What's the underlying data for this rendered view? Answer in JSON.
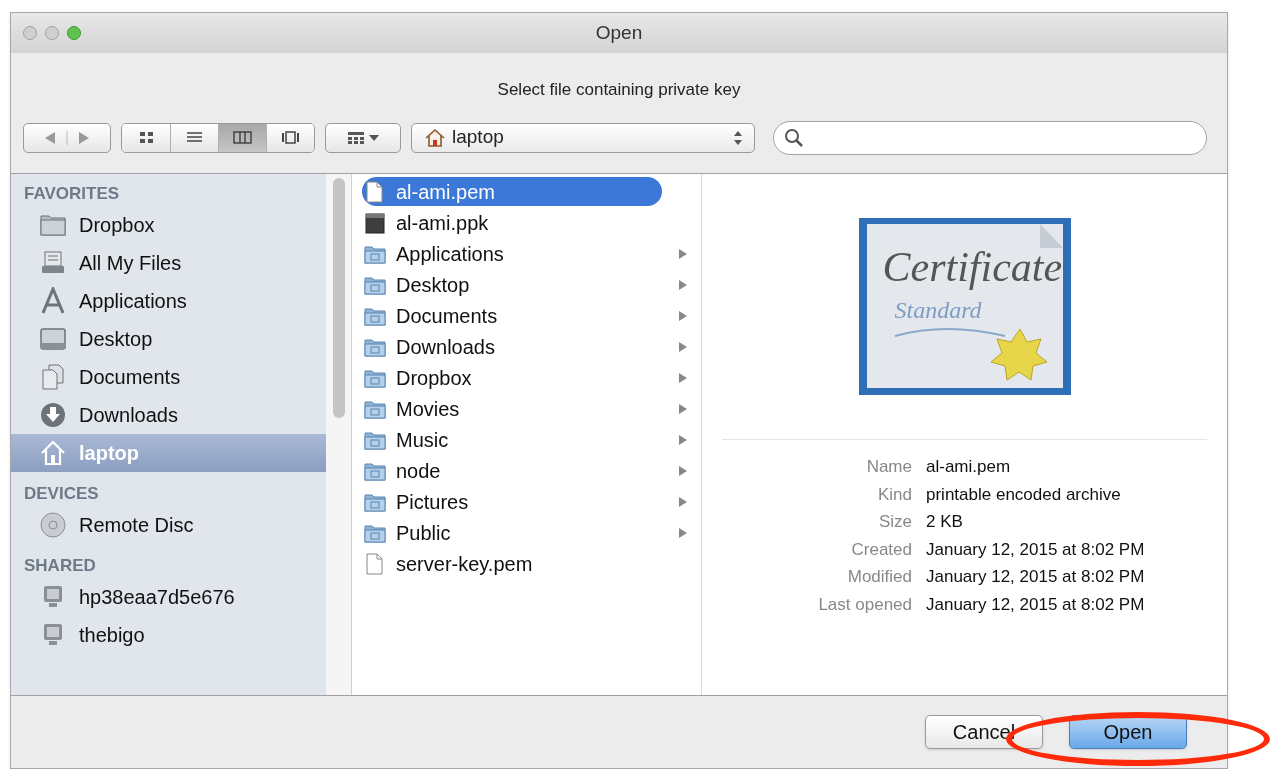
{
  "window": {
    "title": "Open"
  },
  "prompt": "Select file containing private key",
  "toolbar": {
    "views": [
      {
        "kind": "icons",
        "selected": false
      },
      {
        "kind": "list",
        "selected": false
      },
      {
        "kind": "columns",
        "selected": true
      },
      {
        "kind": "coverflow",
        "selected": false
      }
    ],
    "location": "laptop"
  },
  "sidebar": {
    "sections": [
      {
        "title": "FAVORITES",
        "items": [
          {
            "label": "Dropbox",
            "kind": "folder",
            "selected": false
          },
          {
            "label": "All My Files",
            "kind": "files",
            "selected": false
          },
          {
            "label": "Applications",
            "kind": "apps",
            "selected": false
          },
          {
            "label": "Desktop",
            "kind": "desktop",
            "selected": false
          },
          {
            "label": "Documents",
            "kind": "documents",
            "selected": false
          },
          {
            "label": "Downloads",
            "kind": "downloads",
            "selected": false
          },
          {
            "label": "laptop",
            "kind": "home",
            "selected": true
          }
        ]
      },
      {
        "title": "DEVICES",
        "items": [
          {
            "label": "Remote Disc",
            "kind": "disc",
            "selected": false
          }
        ]
      },
      {
        "title": "SHARED",
        "items": [
          {
            "label": "hp38eaa7d5e676",
            "kind": "computer",
            "selected": false
          },
          {
            "label": "thebigo",
            "kind": "computer",
            "selected": false
          }
        ]
      }
    ]
  },
  "files": [
    {
      "name": "al-ami.pem",
      "kind": "document",
      "expandable": false,
      "selected": true
    },
    {
      "name": "al-ami.ppk",
      "kind": "dark-document",
      "expandable": false,
      "selected": false
    },
    {
      "name": "Applications",
      "kind": "folder",
      "expandable": true,
      "selected": false
    },
    {
      "name": "Desktop",
      "kind": "folder",
      "expandable": true,
      "selected": false
    },
    {
      "name": "Documents",
      "kind": "folder",
      "expandable": true,
      "selected": false
    },
    {
      "name": "Downloads",
      "kind": "folder",
      "expandable": true,
      "selected": false
    },
    {
      "name": "Dropbox",
      "kind": "folder",
      "expandable": true,
      "selected": false
    },
    {
      "name": "Movies",
      "kind": "folder",
      "expandable": true,
      "selected": false
    },
    {
      "name": "Music",
      "kind": "folder",
      "expandable": true,
      "selected": false
    },
    {
      "name": "node",
      "kind": "folder",
      "expandable": true,
      "selected": false
    },
    {
      "name": "Pictures",
      "kind": "folder",
      "expandable": true,
      "selected": false
    },
    {
      "name": "Public",
      "kind": "folder",
      "expandable": true,
      "selected": false
    },
    {
      "name": "server-key.pem",
      "kind": "document",
      "expandable": false,
      "selected": false
    }
  ],
  "preview": {
    "certificate_title": "Certificate",
    "certificate_subtitle": "Standard",
    "info": [
      {
        "label": "Name",
        "value": "al-ami.pem"
      },
      {
        "label": "Kind",
        "value": "printable encoded archive"
      },
      {
        "label": "Size",
        "value": "2 KB"
      },
      {
        "label": "Created",
        "value": "January 12, 2015 at 8:02 PM"
      },
      {
        "label": "Modified",
        "value": "January 12, 2015 at 8:02 PM"
      },
      {
        "label": "Last opened",
        "value": "January 12, 2015 at 8:02 PM"
      }
    ]
  },
  "buttons": [
    {
      "label": "Cancel",
      "kind": "default"
    },
    {
      "label": "Open",
      "kind": "primary"
    }
  ],
  "annotation": {
    "kind": "ellipse"
  }
}
